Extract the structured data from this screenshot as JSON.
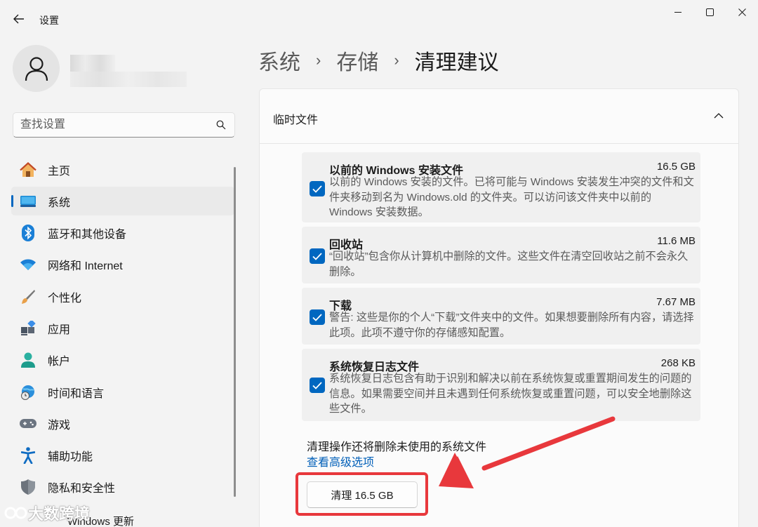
{
  "window": {
    "title": "设置",
    "controls": [
      "minimize",
      "maximize",
      "close"
    ]
  },
  "sidebar": {
    "search_placeholder": "查找设置",
    "items": [
      {
        "label": "主页",
        "icon": "home-icon"
      },
      {
        "label": "系统",
        "icon": "system-icon",
        "active": true
      },
      {
        "label": "蓝牙和其他设备",
        "icon": "bluetooth-icon"
      },
      {
        "label": "网络和 Internet",
        "icon": "wifi-icon"
      },
      {
        "label": "个性化",
        "icon": "brush-icon"
      },
      {
        "label": "应用",
        "icon": "apps-icon"
      },
      {
        "label": "帐户",
        "icon": "account-icon"
      },
      {
        "label": "时间和语言",
        "icon": "globe-clock-icon"
      },
      {
        "label": "游戏",
        "icon": "gamepad-icon"
      },
      {
        "label": "辅助功能",
        "icon": "accessibility-icon"
      },
      {
        "label": "隐私和安全性",
        "icon": "shield-icon"
      }
    ],
    "partial_item": "Windows 更新"
  },
  "breadcrumb": {
    "items": [
      "系统",
      "存储"
    ],
    "current": "清理建议",
    "separator": "›"
  },
  "card": {
    "title": "临时文件",
    "files": [
      {
        "title": "以前的 Windows 安装文件",
        "size": "16.5 GB",
        "checked": true,
        "description": "以前的 Windows 安装的文件。已将可能与 Windows 安装发生冲突的文件和文件夹移动到名为 Windows.old 的文件夹。可以访问该文件夹中以前的 Windows 安装数据。"
      },
      {
        "title": "回收站",
        "size": "11.6 MB",
        "checked": true,
        "description": "“回收站”包含你从计算机中删除的文件。这些文件在清空回收站之前不会永久删除。"
      },
      {
        "title": "下载",
        "size": "7.67 MB",
        "checked": true,
        "description": "警告: 这些是你的个人“下载”文件夹中的文件。如果想要删除所有内容，请选择此项。此项不遵守你的存储感知配置。"
      },
      {
        "title": "系统恢复日志文件",
        "size": "268 KB",
        "checked": true,
        "description": "系统恢复日志包含有助于识别和解决以前在系统恢复或重置期间发生的问题的信息。如果需要空间并且未遇到任何系统恢复或重置问题，可以安全地删除这些文件。"
      }
    ],
    "note": "清理操作还将删除未使用的系统文件",
    "advanced_link": "查看高级选项",
    "clean_button": "清理 16.5 GB"
  },
  "annotations": {
    "highlight_color": "#e8383c",
    "watermark": "大数跨境"
  },
  "colors": {
    "accent": "#0067c0",
    "link": "#005fb8",
    "background": "#f3f3f3"
  }
}
